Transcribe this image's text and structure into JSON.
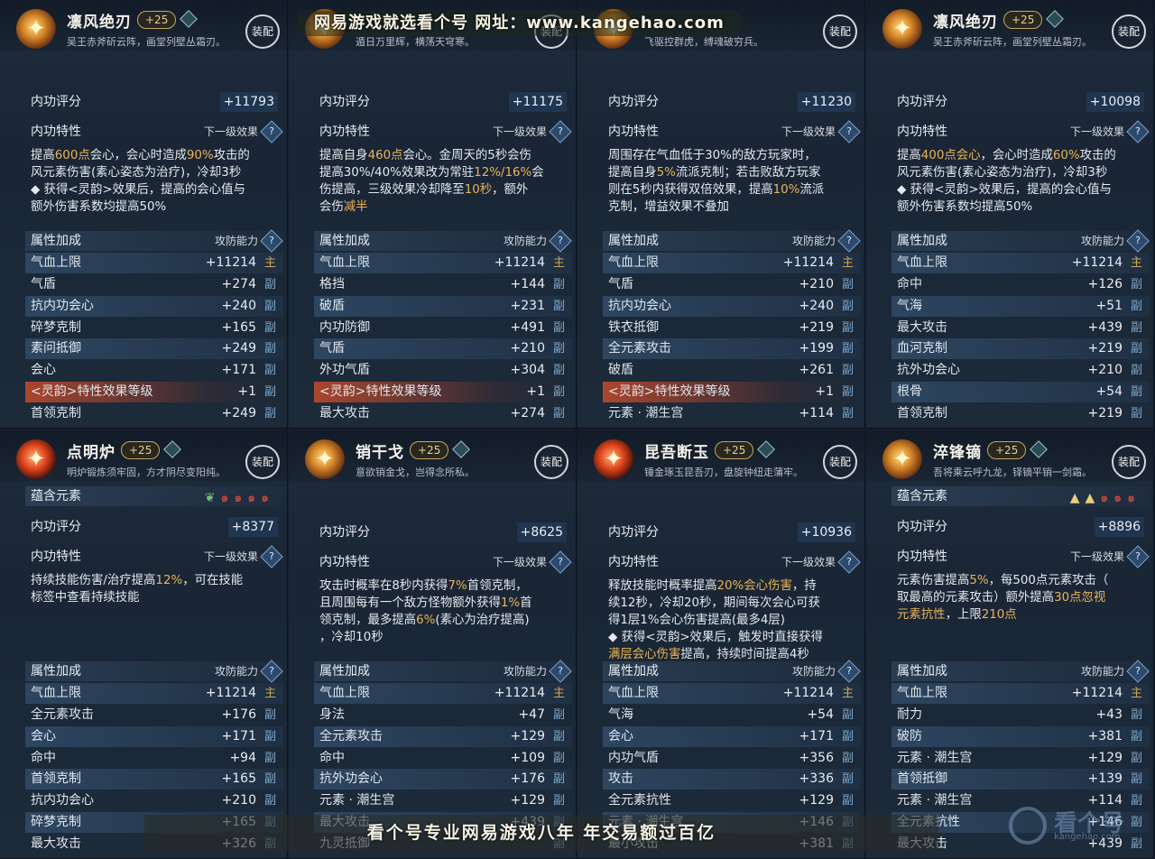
{
  "watermark": {
    "top": "网易游戏就选看个号   网址：www.kangehao.com",
    "bottom": "看个号专业网易游戏八年   年交易额过百亿",
    "logo_text": "看个号",
    "logo_sub": "kangehao.com"
  },
  "labels": {
    "equip": "装配",
    "score": "内功评分",
    "trait": "内功特性",
    "next": "下一级效果",
    "attr": "属性加成",
    "power": "攻防能力",
    "elements": "蕴含元素",
    "help": "?",
    "main_tag": "主",
    "sub_tag": "副"
  },
  "panels": [
    {
      "name": "凛风绝刃",
      "level": "+25",
      "desc": "吴王赤斧斫云阵，画堂列壁丛霜刃。",
      "score": "+11793",
      "trait": [
        {
          "t": "提高"
        },
        {
          "t": "600点",
          "h": true
        },
        {
          "t": "会心，会心时造成"
        },
        {
          "t": "90%",
          "h": true
        },
        {
          "t": "攻击的\n风元素伤害(素心姿态为治疗)，冷却3秒\n◆ 获得<灵韵>效果后，提高的会心值与\n额外伤害系数均提高50%"
        }
      ],
      "attrs": [
        {
          "label": "气血上限",
          "value": "+11214",
          "tag": "主"
        },
        {
          "label": "气盾",
          "value": "+274",
          "tag": "副"
        },
        {
          "label": "抗内功会心",
          "value": "+240",
          "tag": "副"
        },
        {
          "label": "碎梦克制",
          "value": "+165",
          "tag": "副"
        },
        {
          "label": "素问抵御",
          "value": "+249",
          "tag": "副"
        },
        {
          "label": "会心",
          "value": "+171",
          "tag": "副"
        },
        {
          "label": "<灵韵>特性效果等级",
          "value": "+1",
          "tag": "副",
          "ling": true
        },
        {
          "label": "首领克制",
          "value": "+249",
          "tag": "副"
        }
      ]
    },
    {
      "name": "",
      "level": "",
      "desc": "遁日万里辉，横荡天穹寒。",
      "score": "+11175",
      "trait": [
        {
          "t": "提高自身"
        },
        {
          "t": "460点",
          "h": true
        },
        {
          "t": "会心。金周天的5秒会伤\n提高30%/40%效果改为常驻"
        },
        {
          "t": "12%/16%",
          "h": true
        },
        {
          "t": "会\n伤提高，三级效果冷却降至"
        },
        {
          "t": "10秒",
          "h": true
        },
        {
          "t": "，额外\n会伤"
        },
        {
          "t": "减半",
          "h": true
        }
      ],
      "attrs": [
        {
          "label": "气血上限",
          "value": "+11214",
          "tag": "主"
        },
        {
          "label": "格挡",
          "value": "+144",
          "tag": "副"
        },
        {
          "label": "破盾",
          "value": "+231",
          "tag": "副"
        },
        {
          "label": "内功防御",
          "value": "+491",
          "tag": "副"
        },
        {
          "label": "气盾",
          "value": "+210",
          "tag": "副"
        },
        {
          "label": "外功气盾",
          "value": "+304",
          "tag": "副"
        },
        {
          "label": "<灵韵>特性效果等级",
          "value": "+1",
          "tag": "副",
          "ling": true
        },
        {
          "label": "最大攻击",
          "value": "+274",
          "tag": "副"
        }
      ]
    },
    {
      "name": "",
      "level": "",
      "desc": "飞驱控群虎，缚魂破穷兵。",
      "score": "+11230",
      "trait": [
        {
          "t": "周围存在气血低于30%的敌方玩家时，\n提高自身"
        },
        {
          "t": "5%",
          "h": true
        },
        {
          "t": "流派克制；若击败敌方玩家\n则在5秒内获得双倍效果，提高"
        },
        {
          "t": "10%",
          "h": true
        },
        {
          "t": "流派\n克制，增益效果不叠加"
        }
      ],
      "attrs": [
        {
          "label": "气血上限",
          "value": "+11214",
          "tag": "主"
        },
        {
          "label": "气盾",
          "value": "+210",
          "tag": "副"
        },
        {
          "label": "抗内功会心",
          "value": "+240",
          "tag": "副"
        },
        {
          "label": "铁衣抵御",
          "value": "+219",
          "tag": "副"
        },
        {
          "label": "全元素攻击",
          "value": "+199",
          "tag": "副"
        },
        {
          "label": "破盾",
          "value": "+261",
          "tag": "副"
        },
        {
          "label": "<灵韵>特性效果等级",
          "value": "+1",
          "tag": "副",
          "ling": true
        },
        {
          "label": "元素 · 潮生宫",
          "value": "+114",
          "tag": "副"
        }
      ]
    },
    {
      "name": "凛风绝刃",
      "level": "+25",
      "desc": "吴王赤斧斫云阵，画堂列壁丛霜刃。",
      "score": "+10098",
      "trait": [
        {
          "t": "提高"
        },
        {
          "t": "400点会心",
          "h": true
        },
        {
          "t": "，会心时造成"
        },
        {
          "t": "60%",
          "h": true
        },
        {
          "t": "攻击的\n风元素伤害(素心姿态为治疗)，冷却3秒\n◆ 获得<灵韵>效果后，提高的会心值与\n额外伤害系数均提高50%"
        }
      ],
      "attrs": [
        {
          "label": "气血上限",
          "value": "+11214",
          "tag": "主"
        },
        {
          "label": "命中",
          "value": "+126",
          "tag": "副"
        },
        {
          "label": "气海",
          "value": "+51",
          "tag": "副"
        },
        {
          "label": "最大攻击",
          "value": "+439",
          "tag": "副"
        },
        {
          "label": "血河克制",
          "value": "+219",
          "tag": "副"
        },
        {
          "label": "抗外功会心",
          "value": "+210",
          "tag": "副"
        },
        {
          "label": "根骨",
          "value": "+54",
          "tag": "副"
        },
        {
          "label": "首领克制",
          "value": "+219",
          "tag": "副"
        }
      ]
    },
    {
      "name": "点明炉",
      "level": "+25",
      "desc": "明炉锻炼须牢固，方才阴尽变阳纯。",
      "score": "+8377",
      "elements": [
        "leaf",
        "fire",
        "fire",
        "fire",
        "fire"
      ],
      "trait": [
        {
          "t": "持续技能伤害/治疗提高"
        },
        {
          "t": "12%",
          "h": true
        },
        {
          "t": "，可在技能\n标签中查看持续技能"
        }
      ],
      "attrs": [
        {
          "label": "气血上限",
          "value": "+11214",
          "tag": "主"
        },
        {
          "label": "全元素攻击",
          "value": "+176",
          "tag": "副"
        },
        {
          "label": "会心",
          "value": "+171",
          "tag": "副"
        },
        {
          "label": "命中",
          "value": "+94",
          "tag": "副"
        },
        {
          "label": "首领克制",
          "value": "+165",
          "tag": "副"
        },
        {
          "label": "抗内功会心",
          "value": "+210",
          "tag": "副"
        },
        {
          "label": "碎梦克制",
          "value": "+165",
          "tag": "副"
        },
        {
          "label": "最大攻击",
          "value": "+326",
          "tag": "副"
        }
      ]
    },
    {
      "name": "销干戈",
      "level": "+25",
      "desc": "意欲销金戈，岂得念所私。",
      "score": "+8625",
      "trait": [
        {
          "t": "攻击时概率在8秒内获得"
        },
        {
          "t": "7%",
          "h": true
        },
        {
          "t": "首领克制，\n且周围每有一个敌方怪物额外获得"
        },
        {
          "t": "1%",
          "h": true
        },
        {
          "t": "首\n领克制，最多提高"
        },
        {
          "t": "6%",
          "h": true
        },
        {
          "t": "(素心为治疗提高)\n，冷却10秒"
        }
      ],
      "attrs": [
        {
          "label": "气血上限",
          "value": "+11214",
          "tag": "主"
        },
        {
          "label": "身法",
          "value": "+47",
          "tag": "副"
        },
        {
          "label": "全元素攻击",
          "value": "+129",
          "tag": "副"
        },
        {
          "label": "命中",
          "value": "+109",
          "tag": "副"
        },
        {
          "label": "抗外功会心",
          "value": "+176",
          "tag": "副"
        },
        {
          "label": "元素 · 潮生宫",
          "value": "+129",
          "tag": "副"
        },
        {
          "label": "最大攻击",
          "value": "+439",
          "tag": "副"
        },
        {
          "label": "九灵抵御",
          "value": "",
          "tag": "副"
        }
      ]
    },
    {
      "name": "昆吾断玉",
      "level": "+25",
      "desc": "锤金琢玉昆吾刃，盘旋钟纽走蒲牢。",
      "score": "+10936",
      "trait": [
        {
          "t": "释放技能时概率提高"
        },
        {
          "t": "20%会心伤害",
          "h": true
        },
        {
          "t": "，持\n续12秒，冷却20秒，期间每次会心可获\n得1层1%会心伤害提高(最多4层)\n◆ 获得<灵韵>效果后，触发时直接获得\n"
        },
        {
          "t": "满层会心伤害",
          "h": true
        },
        {
          "t": "提高，持续时间提高4秒"
        }
      ],
      "attrs": [
        {
          "label": "气血上限",
          "value": "+11214",
          "tag": "主"
        },
        {
          "label": "气海",
          "value": "+54",
          "tag": "副"
        },
        {
          "label": "会心",
          "value": "+171",
          "tag": "副"
        },
        {
          "label": "内功气盾",
          "value": "+356",
          "tag": "副"
        },
        {
          "label": "攻击",
          "value": "+336",
          "tag": "副"
        },
        {
          "label": "全元素抗性",
          "value": "+129",
          "tag": "副"
        },
        {
          "label": "元素 · 潮生宫",
          "value": "+146",
          "tag": "副"
        },
        {
          "label": "最小攻击",
          "value": "+381",
          "tag": "副"
        }
      ]
    },
    {
      "name": "淬锋镝",
      "level": "+25",
      "desc": "吾将乘云呼九龙，铎镝平销一剑霜。",
      "score": "+8896",
      "elements": [
        "tri",
        "tri",
        "fire",
        "fire",
        "fire"
      ],
      "trait": [
        {
          "t": "元素伤害提高"
        },
        {
          "t": "5%",
          "h": true
        },
        {
          "t": "，每500点元素攻击（\n取最高的元素攻击）额外提高"
        },
        {
          "t": "30点忽视\n元素抗性",
          "h": true
        },
        {
          "t": "，上限"
        },
        {
          "t": "210点",
          "h": true
        }
      ],
      "attrs": [
        {
          "label": "气血上限",
          "value": "+11214",
          "tag": "主"
        },
        {
          "label": "耐力",
          "value": "+43",
          "tag": "副"
        },
        {
          "label": "破防",
          "value": "+381",
          "tag": "副"
        },
        {
          "label": "元素 · 潮生宫",
          "value": "+129",
          "tag": "副"
        },
        {
          "label": "首领抵御",
          "value": "+139",
          "tag": "副"
        },
        {
          "label": "元素 · 潮生宫",
          "value": "+114",
          "tag": "副"
        },
        {
          "label": "全元素抗性",
          "value": "+146",
          "tag": "副"
        },
        {
          "label": "最大攻击",
          "value": "+439",
          "tag": "副"
        }
      ]
    }
  ]
}
